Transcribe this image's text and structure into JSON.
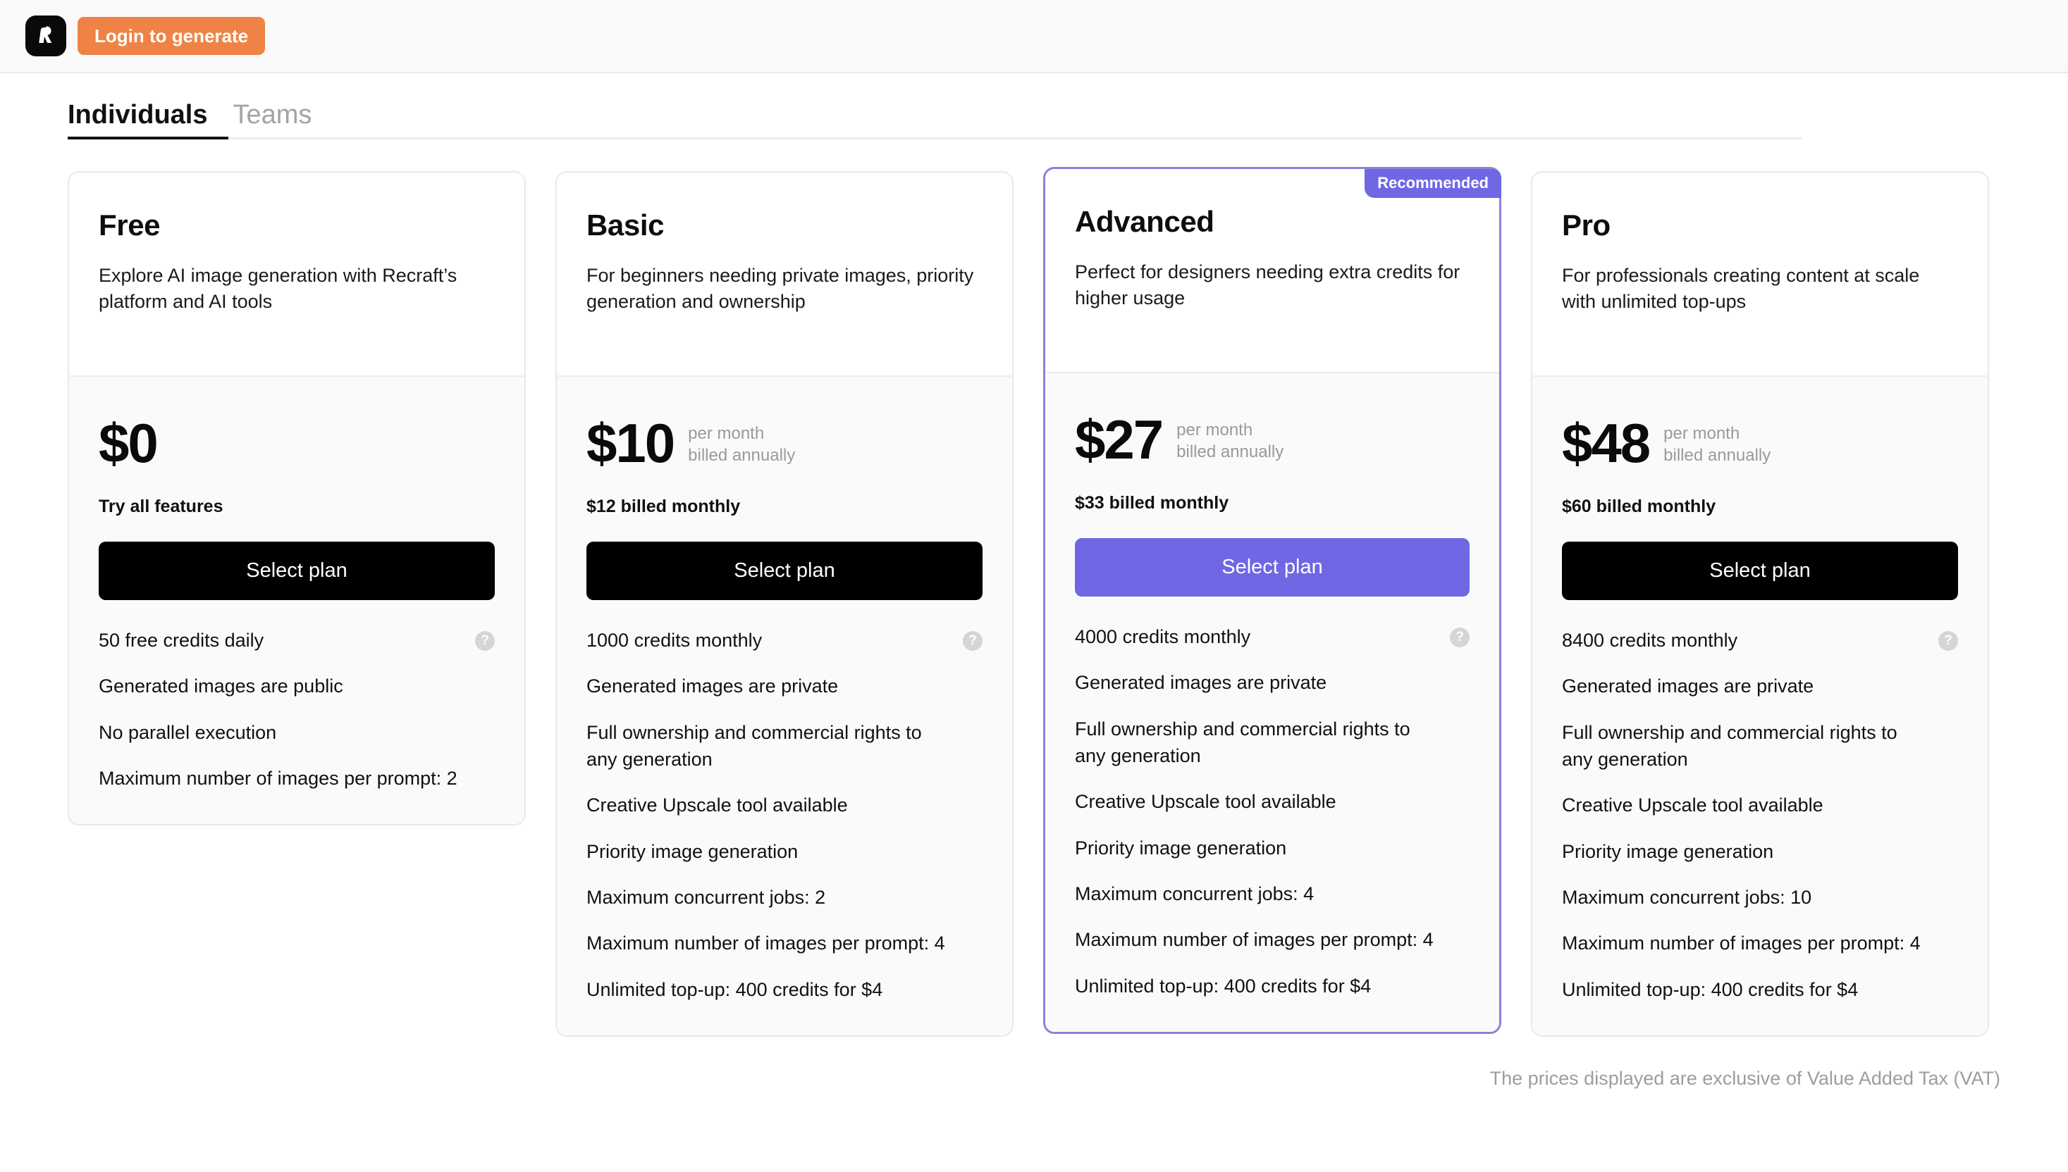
{
  "header": {
    "logo_icon": "recraft-logo-icon",
    "login_label": "Login to generate"
  },
  "tabs": [
    {
      "label": "Individuals",
      "active": true
    },
    {
      "label": "Teams",
      "active": false
    }
  ],
  "colors": {
    "accent_orange": "#ef8345",
    "accent_purple": "#6f67e3",
    "featured_border": "#8b82dd",
    "button_black": "#000000",
    "card_body_bg": "#fafafa",
    "muted_text": "#9a9a9a"
  },
  "help_icon_glyph": "?",
  "plans": [
    {
      "name": "Free",
      "description": "Explore AI image generation with Recraft’s platform and AI tools",
      "price": "$0",
      "price_sub_line1": "",
      "price_sub_line2": "",
      "billed_note": "Try all features",
      "cta": "Select plan",
      "cta_style": "black",
      "recommended": false,
      "badge": "",
      "features": [
        {
          "text": "50 free credits daily",
          "help": true
        },
        {
          "text": "Generated images are public",
          "help": false
        },
        {
          "text": "No parallel execution",
          "help": false
        },
        {
          "text": "Maximum number of images per prompt: 2",
          "help": false
        }
      ]
    },
    {
      "name": "Basic",
      "description": "For beginners needing private images, priority generation and ownership",
      "price": "$10",
      "price_sub_line1": "per month",
      "price_sub_line2": "billed annually",
      "billed_note": "$12 billed monthly",
      "cta": "Select plan",
      "cta_style": "black",
      "recommended": false,
      "badge": "",
      "features": [
        {
          "text": "1000 credits monthly",
          "help": true
        },
        {
          "text": "Generated images are private",
          "help": false
        },
        {
          "text": "Full ownership and commercial rights to any generation",
          "help": false
        },
        {
          "text": "Creative Upscale tool available",
          "help": false
        },
        {
          "text": "Priority image generation",
          "help": false
        },
        {
          "text": "Maximum concurrent jobs: 2",
          "help": false
        },
        {
          "text": "Maximum number of images per prompt: 4",
          "help": false
        },
        {
          "text": "Unlimited top-up: 400 credits for $4",
          "help": false
        }
      ]
    },
    {
      "name": "Advanced",
      "description": "Perfect for designers needing extra credits for higher usage",
      "price": "$27",
      "price_sub_line1": "per month",
      "price_sub_line2": "billed annually",
      "billed_note": "$33 billed monthly",
      "cta": "Select plan",
      "cta_style": "purple",
      "recommended": true,
      "badge": "Recommended",
      "features": [
        {
          "text": "4000 credits monthly",
          "help": true
        },
        {
          "text": "Generated images are private",
          "help": false
        },
        {
          "text": "Full ownership and commercial rights to any generation",
          "help": false
        },
        {
          "text": "Creative Upscale tool available",
          "help": false
        },
        {
          "text": "Priority image generation",
          "help": false
        },
        {
          "text": "Maximum concurrent jobs: 4",
          "help": false
        },
        {
          "text": "Maximum number of images per prompt: 4",
          "help": false
        },
        {
          "text": "Unlimited top-up: 400 credits for $4",
          "help": false
        }
      ]
    },
    {
      "name": "Pro",
      "description": "For professionals creating content at scale with unlimited top-ups",
      "price": "$48",
      "price_sub_line1": "per month",
      "price_sub_line2": "billed annually",
      "billed_note": "$60 billed monthly",
      "cta": "Select plan",
      "cta_style": "black",
      "recommended": false,
      "badge": "",
      "features": [
        {
          "text": "8400 credits monthly",
          "help": true
        },
        {
          "text": "Generated images are private",
          "help": false
        },
        {
          "text": "Full ownership and commercial rights to any generation",
          "help": false
        },
        {
          "text": "Creative Upscale tool available",
          "help": false
        },
        {
          "text": "Priority image generation",
          "help": false
        },
        {
          "text": "Maximum concurrent jobs: 10",
          "help": false
        },
        {
          "text": "Maximum number of images per prompt: 4",
          "help": false
        },
        {
          "text": "Unlimited top-up: 400 credits for $4",
          "help": false
        }
      ]
    }
  ],
  "footer": {
    "vat_note": "The prices displayed are exclusive of Value Added Tax (VAT)"
  }
}
